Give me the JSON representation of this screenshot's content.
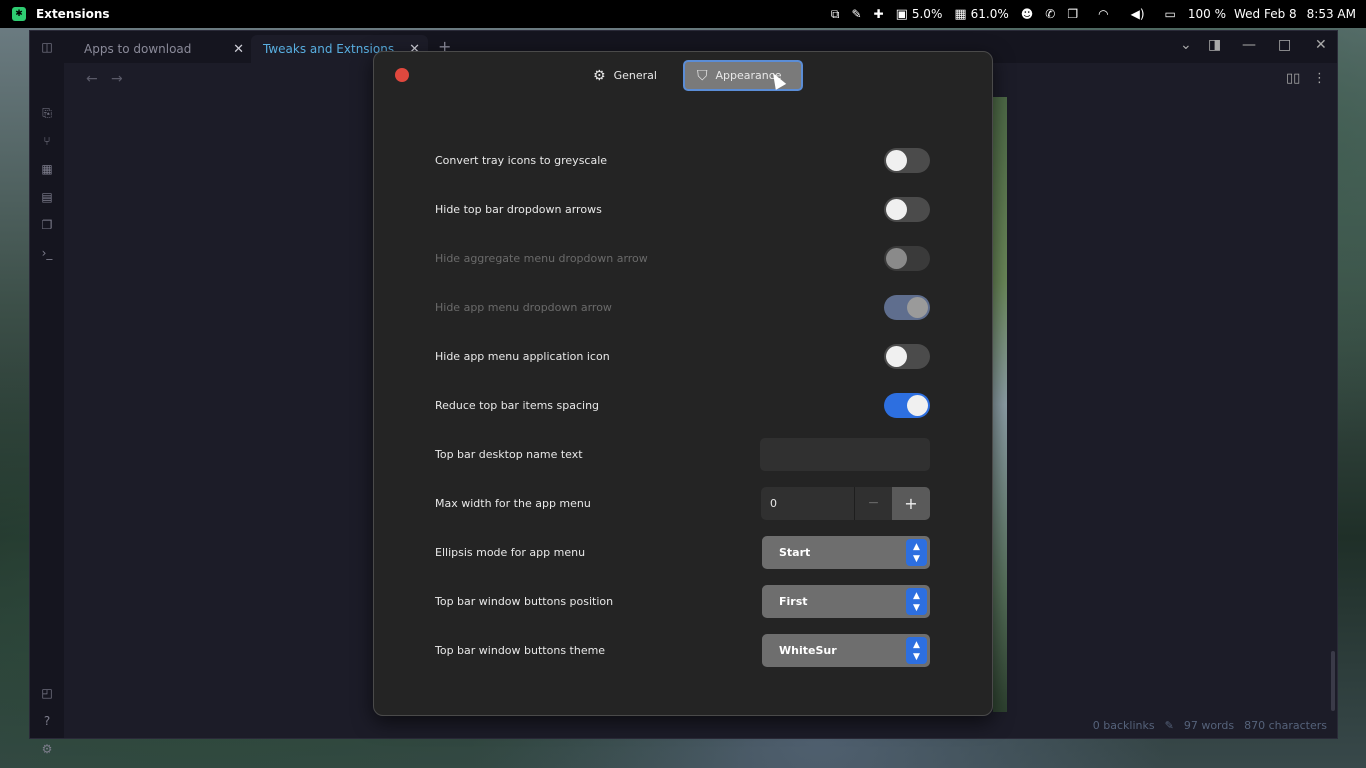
{
  "topbar": {
    "app_name": "Extensions",
    "tray": {
      "cpu": "5.0%",
      "mem": "61.0%",
      "battery": "100 %",
      "date": "Wed Feb 8",
      "time": "8:53 AM"
    },
    "icons": [
      "window-switch-icon",
      "color-picker-icon",
      "extension-icon",
      "cpu-icon",
      "memory-icon",
      "face-icon",
      "whatsapp-icon",
      "copy-icon",
      "wifi-icon",
      "volume-icon",
      "battery-icon"
    ]
  },
  "obsidian": {
    "tabs": [
      {
        "label": "Apps to download"
      },
      {
        "label": "Tweaks and Extnsions"
      }
    ],
    "status": {
      "backlinks": "0 backlinks",
      "words": "97 words",
      "chars": "870 characters"
    }
  },
  "dialog": {
    "tabs": [
      {
        "label": "General",
        "icon": "gear-icon"
      },
      {
        "label": "Appearance",
        "icon": "paint-bucket-icon"
      }
    ],
    "rows": [
      {
        "label": "Convert tray icons to greyscale",
        "type": "switch",
        "state": "off",
        "enabled": true
      },
      {
        "label": "Hide top bar dropdown arrows",
        "type": "switch",
        "state": "off",
        "enabled": true
      },
      {
        "label": "Hide aggregate menu dropdown arrow",
        "type": "switch",
        "state": "off",
        "enabled": false
      },
      {
        "label": "Hide app menu dropdown arrow",
        "type": "switch",
        "state": "on",
        "enabled": false
      },
      {
        "label": "Hide app menu application icon",
        "type": "switch",
        "state": "off",
        "enabled": true
      },
      {
        "label": "Reduce top bar items spacing",
        "type": "switch",
        "state": "on",
        "enabled": true
      },
      {
        "label": "Top bar desktop name text",
        "type": "entry",
        "value": ""
      },
      {
        "label": "Max width for the app menu",
        "type": "spin",
        "value": "0"
      },
      {
        "label": "Ellipsis mode for app menu",
        "type": "combo",
        "value": "Start"
      },
      {
        "label": "Top bar window buttons position",
        "type": "combo",
        "value": "First"
      },
      {
        "label": "Top bar window buttons theme",
        "type": "combo",
        "value": "WhiteSur"
      }
    ],
    "colors": {
      "accent": "#2d6fe0",
      "close": "#e0483e"
    }
  }
}
